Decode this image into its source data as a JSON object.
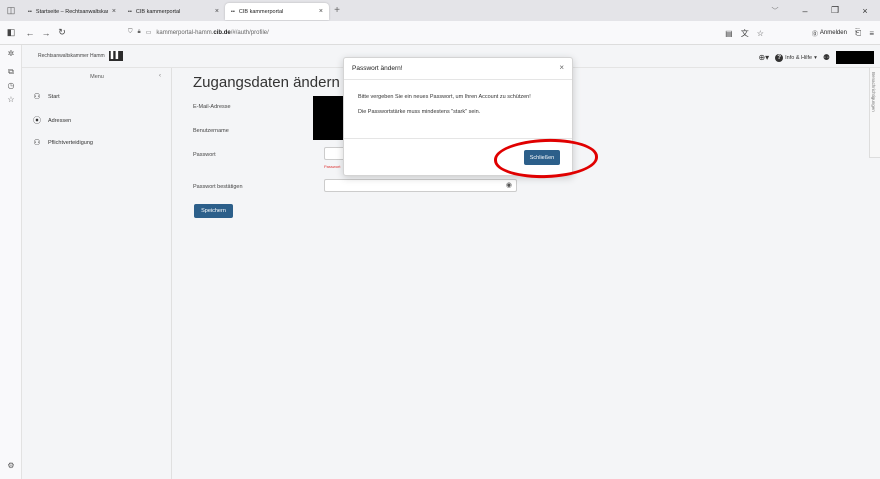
{
  "browser": {
    "tabs": [
      {
        "label": "Startseite – Rechtsanwaltskam",
        "favicon": "▪▪"
      },
      {
        "label": "CIB kammerportal",
        "favicon": "▪▪"
      },
      {
        "label": "CIB kammerportal",
        "favicon": "▪▪"
      }
    ],
    "url_prefix": "kammerportal-hamm.",
    "url_domain": "cib.de",
    "url_path": "/#/auth/profile/",
    "signin_label": "Anmelden"
  },
  "app": {
    "brand_text": "Rechtsanwaltskammer Hamm",
    "logo_text": "▌▌",
    "help_label": "Info & Hilfe",
    "side_tab_label": "Benachrichtigungen"
  },
  "menu": {
    "title": "Menu",
    "collapse_glyph": "‹",
    "items": [
      {
        "label": "Start",
        "icon": "user-group-icon",
        "glyph": "⚇"
      },
      {
        "label": "Adressen",
        "icon": "location-pin-icon",
        "glyph": "⦿"
      },
      {
        "label": "Pflichtverteidigung",
        "icon": "people-icon",
        "glyph": "⚇"
      }
    ]
  },
  "page": {
    "title": "Zugangsdaten ändern",
    "fields": {
      "email_label": "E-Mail-Adresse",
      "username_label": "Benutzername",
      "password_label": "Passwort",
      "password_confirm_label": "Passwort bestätigen",
      "password_hint": "Passwort"
    },
    "save_label": "Speichern"
  },
  "modal": {
    "title": "Passwort ändern!",
    "close_glyph": "×",
    "line1": "Bitte vergeben Sie ein neues Passwort, um Ihren Account zu schützen!",
    "line2": "Die Passwortstärke muss mindestens \"stark\" sein.",
    "close_label": "Schließen"
  },
  "colors": {
    "primary": "#2c5f8a",
    "annotation": "#e00000"
  }
}
